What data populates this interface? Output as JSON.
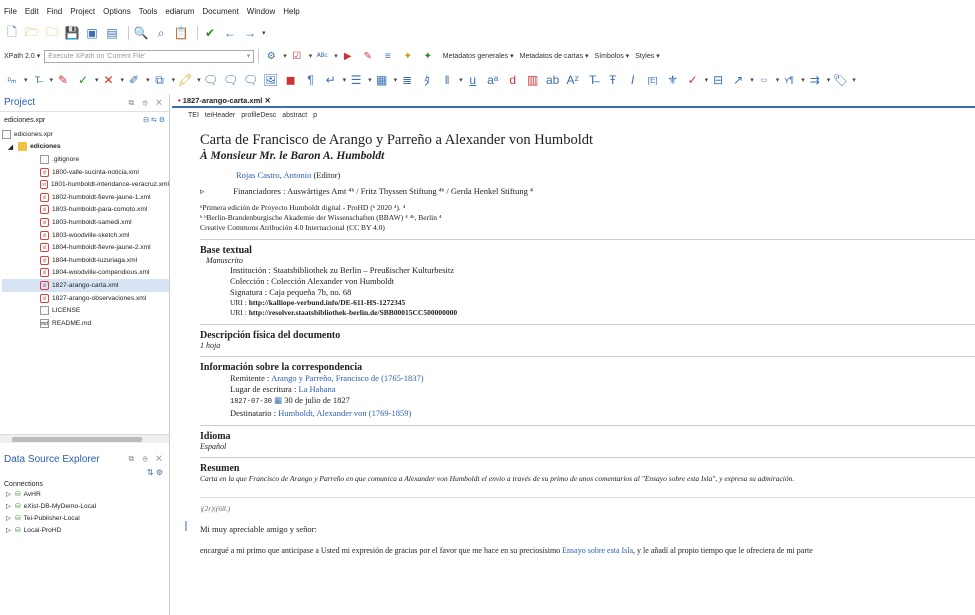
{
  "menu": [
    "File",
    "Edit",
    "Find",
    "Project",
    "Options",
    "Tools",
    "ediarum",
    "Document",
    "Window",
    "Help"
  ],
  "toolbar2": {
    "xpath_label": "XPath 2.0",
    "xpath_placeholder": "Execute XPath on 'Current File'",
    "metadatos_generales": "Metadatos generales",
    "metadatos_cartas": "Metadatos de cartas",
    "simbolos": "Símbolos",
    "styles": "Styles"
  },
  "project": {
    "title": "Project",
    "combo": "ediciones.xpr",
    "root": "ediciones.xpr",
    "folder": "ediciones",
    "files": [
      ".gitignore",
      "1800-valle-sucinta-noticia.xml",
      "1801-humboldt-intendance-veracruz.xml",
      "1802-humboldt-fievre-jaune-1.xml",
      "1803-humboldt-para-comoto.xml",
      "1803-humboldt-samedi.xml",
      "1803-woodville-sketch.xml",
      "1804-humboldt-fievre-jaune-2.xml",
      "1804-humboldt-luzuriaga.xml",
      "1804-woodville-compendious.xml",
      "1827-arango-carta.xml",
      "1827-arango-observaciones.xml",
      "LICENSE",
      "README.md"
    ]
  },
  "dse": {
    "title": "Data Source Explorer",
    "connections_label": "Connections",
    "connections": [
      "AvHR",
      "eXist-DB-MyDemo-Local",
      "Tei-Publisher-Local",
      "Local-ProHD"
    ]
  },
  "editor": {
    "tab": "1827-arango-carta.xml",
    "crumbs": [
      "TEI",
      "teiHeader",
      "profileDesc",
      "abstract",
      "p"
    ]
  },
  "doc": {
    "title": "Carta de Francisco de Arango y Parreño a Alexander von Humboldt",
    "subtitle": "À Monsieur Mr. le Baron A. Humboldt",
    "editor_name": "Rojas Castro, Antonio",
    "editor_role": "(Editor)",
    "funders": "Financiadores : Auswärtiges Amt ⁴ᵇ / Fritz Thyssen Stiftung ⁴ᵇ / Gerda Henkel Stiftung ⁴",
    "pub1": "ᵇPrimera edición de Proyecto Humboldt digital - ProHD (ᵇ 2020 ⁴). ⁴",
    "pub2": "ᵇ ᵇBerlin-Brandenburgische Akademie der Wissenschaften (BBAW) ⁴ ⁴ᵇ, Berlin ⁴",
    "license": "Creative Commons Atribución 4.0 Internacional (CC BY 4.0)",
    "h_base": "Base textual",
    "manuscrito": "Manuscrito",
    "institucion": "Institución : Staatsbibliothek zu Berlin – Preußischer Kulturbesitz",
    "coleccion": "Colección : Colección Alexander von Humboldt",
    "signatura": "Signatura : Caja pequeña 7b, no. 68",
    "uri1_label": "URI : ",
    "uri1": "http://kalliope-verbund.info/DE-611-HS-1272345",
    "uri2_label": "URI : ",
    "uri2": "http://resolver.staatsbibliothek-berlin.de/SBB00015CC500000000",
    "h_desc": "Descripción física del documento",
    "hoja": "1 hoja",
    "h_corr": "Información sobre la correspondencia",
    "remitente_label": "Remitente : ",
    "remitente": "Arango y Parreño, Francisco de (1765-1837)",
    "lugar_label": "Lugar de escritura : ",
    "lugar": "La Habana",
    "date_code": "1827-07-30",
    "date_text": "30 de julio de 1827",
    "dest_label": "Destinatario : ",
    "dest": "Humboldt, Alexander von (1769-1859)",
    "h_idioma": "Idioma",
    "idioma": "Español",
    "h_resumen": "Resumen",
    "resumen": "Carta en la que Francisco de Arango y Parreño en que comunica a Alexander von Humboldt el envío a través de su primo de unos comentarios al \"Ensayo sobre esta Isla\", y expresa su admiración.",
    "folio": "|(2r)|(68.)",
    "saludo": "Mi muy apreciable amigo y señor:",
    "body1": "encargué a mi primo que anticipase a Usted mi expresión de gracias por el favor que me hace en su preciosísimo ",
    "body_link": "Ensayo sobre esta Isla",
    "body2": ", y le añadí al propio tiempo que le ofreciera de mi parte"
  }
}
